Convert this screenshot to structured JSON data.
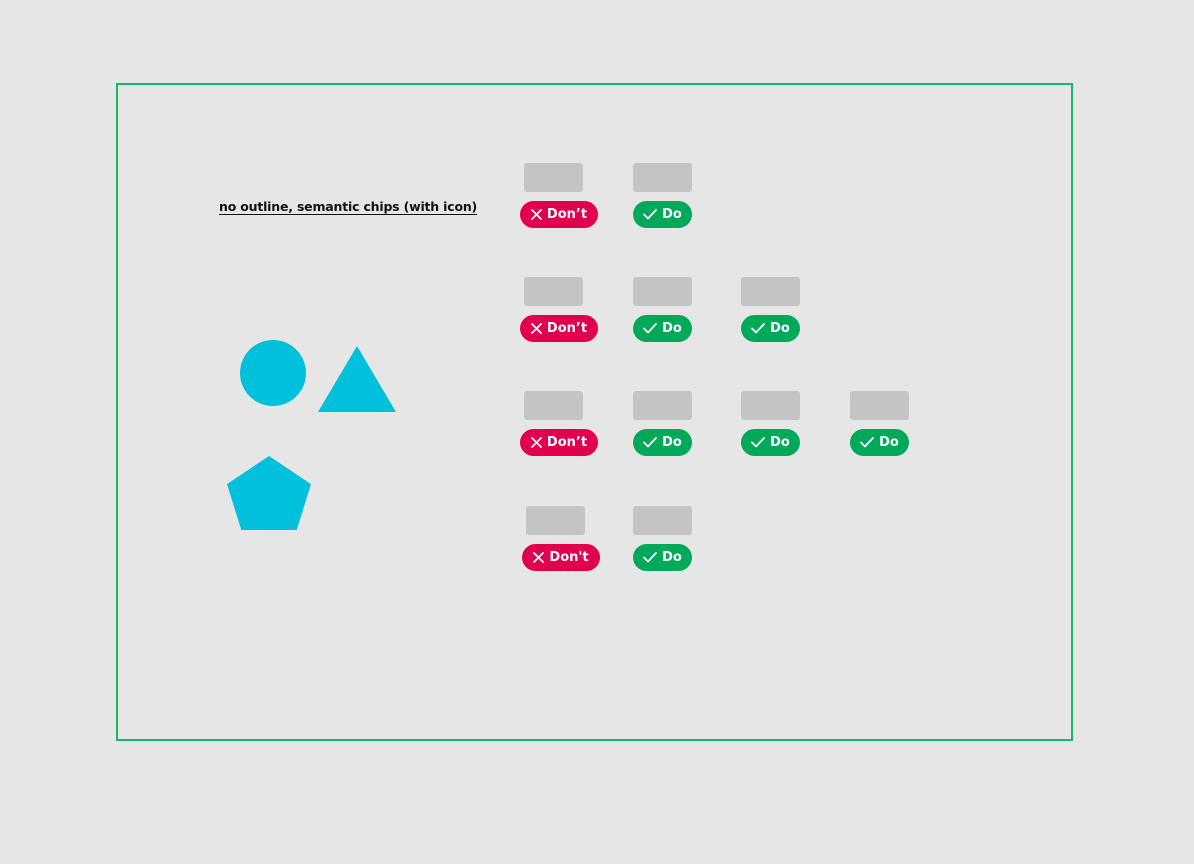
{
  "title": "no outline, semantic chips (with icon)",
  "colors": {
    "frame": "#14b866",
    "dont": "#e0004d",
    "do": "#00a85a",
    "shape": "#00c0dc",
    "placeholder": "#c4c4c4",
    "background": "#e6e6e6"
  },
  "shapes": [
    "circle",
    "triangle",
    "pentagon"
  ],
  "rows": [
    {
      "chips": [
        {
          "type": "dont",
          "label": "Don’t",
          "icon": "x-icon"
        },
        {
          "type": "do",
          "label": "Do",
          "icon": "check-icon"
        }
      ]
    },
    {
      "chips": [
        {
          "type": "dont",
          "label": "Don’t",
          "icon": "x-icon"
        },
        {
          "type": "do",
          "label": "Do",
          "icon": "check-icon"
        },
        {
          "type": "do",
          "label": "Do",
          "icon": "check-icon"
        }
      ]
    },
    {
      "chips": [
        {
          "type": "dont",
          "label": "Don’t",
          "icon": "x-icon"
        },
        {
          "type": "do",
          "label": "Do",
          "icon": "check-icon"
        },
        {
          "type": "do",
          "label": "Do",
          "icon": "check-icon"
        },
        {
          "type": "do",
          "label": "Do",
          "icon": "check-icon"
        }
      ]
    },
    {
      "chips": [
        {
          "type": "dont",
          "label": "Don't",
          "icon": "x-icon"
        },
        {
          "type": "do",
          "label": "Do",
          "icon": "check-icon"
        }
      ]
    }
  ]
}
